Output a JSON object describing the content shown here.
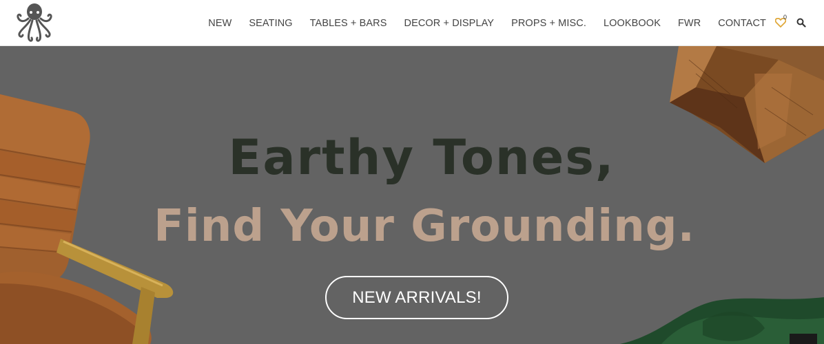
{
  "header": {
    "logo_icon": "octopus-logo-icon",
    "nav": [
      {
        "label": "NEW"
      },
      {
        "label": "SEATING"
      },
      {
        "label": "TABLES + BARS"
      },
      {
        "label": "DECOR + DISPLAY"
      },
      {
        "label": "PROPS + MISC."
      },
      {
        "label": "LOOKBOOK"
      },
      {
        "label": "FWR"
      },
      {
        "label": "CONTACT"
      }
    ],
    "wishlist_count": "0",
    "wishlist_icon": "heart-icon",
    "search_icon": "search-icon"
  },
  "hero": {
    "headline_line1": "Earthy Tones,",
    "headline_line2": "Find Your Grounding.",
    "cta_label": "NEW ARRIVALS!",
    "colors": {
      "background": "#636363",
      "headline_dark": "#2a3128",
      "headline_light": "#bca18d",
      "accent_heart": "#e0a83a"
    }
  }
}
